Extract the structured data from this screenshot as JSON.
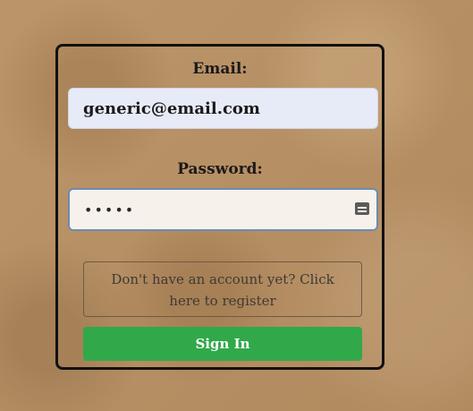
{
  "form": {
    "email_label": "Email:",
    "email_value": "generic@email.com",
    "password_label": "Password:",
    "password_value": "•••••",
    "register_text": "Don't have an account yet? Click here to register",
    "signin_label": "Sign In"
  },
  "icons": {
    "password": "keyboard-icon"
  },
  "colors": {
    "background": "#b88f62",
    "card_border": "#111111",
    "email_field_bg": "#e7ebf7",
    "password_field_bg": "#f6f1ea",
    "password_field_border": "#6d8cb0",
    "signin_button": "#31a84a"
  }
}
